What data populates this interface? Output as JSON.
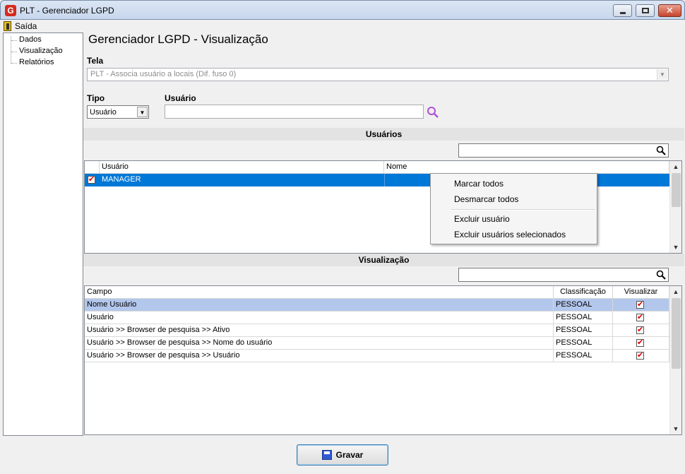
{
  "window": {
    "title": "PLT - Gerenciador LGPD",
    "logo": "G"
  },
  "menu": {
    "exit_label": "Saída"
  },
  "tree": {
    "items": [
      {
        "label": "Dados"
      },
      {
        "label": "Visualização"
      },
      {
        "label": "Relatórios"
      }
    ]
  },
  "main": {
    "title": "Gerenciador LGPD - Visualização",
    "tela_label": "Tela",
    "tela_value": "PLT - Associa usuário a locais (Dif. fuso 0)",
    "tipo_label": "Tipo",
    "tipo_value": "Usuário",
    "usuario_label": "Usuário",
    "usuario_value": ""
  },
  "users_section": {
    "title": "Usuários",
    "search_value": "",
    "columns": {
      "usuario": "Usuário",
      "nome": "Nome"
    },
    "rows": [
      {
        "usuario": "MANAGER",
        "nome": "",
        "checked": true
      }
    ]
  },
  "context_menu": {
    "items": [
      "Marcar todos",
      "Desmarcar todos",
      "Excluir usuário",
      "Excluir usuários selecionados"
    ]
  },
  "view_section": {
    "title": "Visualização",
    "search_value": "",
    "columns": {
      "campo": "Campo",
      "classificacao": "Classificação",
      "visualizar": "Visualizar"
    },
    "rows": [
      {
        "campo": "Nome Usuário",
        "classificacao": "PESSOAL",
        "visualizar": true
      },
      {
        "campo": "Usuário",
        "classificacao": "PESSOAL",
        "visualizar": true
      },
      {
        "campo": "Usuário >> Browser de pesquisa >> Ativo",
        "classificacao": "PESSOAL",
        "visualizar": true
      },
      {
        "campo": "Usuário >> Browser de pesquisa >> Nome do usuário",
        "classificacao": "PESSOAL",
        "visualizar": true
      },
      {
        "campo": "Usuário >> Browser de pesquisa >> Usuário",
        "classificacao": "PESSOAL",
        "visualizar": true
      }
    ]
  },
  "footer": {
    "save_label": "Gravar"
  },
  "colors": {
    "selection": "#0078d7",
    "row_highlight": "#b3c7ec",
    "section_band": "#e3e3e3"
  }
}
